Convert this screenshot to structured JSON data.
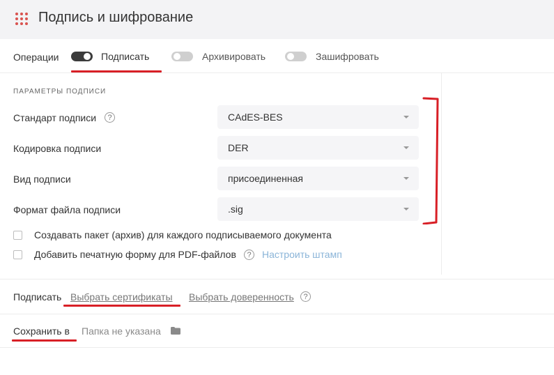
{
  "header": {
    "title": "Подпись и шифрование",
    "icon": "grid-dots-icon",
    "icon_color": "#d9534f"
  },
  "operations": {
    "label": "Операции",
    "toggles": [
      {
        "label": "Подписать",
        "on": true
      },
      {
        "label": "Архивировать",
        "on": false
      },
      {
        "label": "Зашифровать",
        "on": false
      }
    ]
  },
  "params": {
    "section_title": "ПАРАМЕТРЫ ПОДПИСИ",
    "rows": [
      {
        "label": "Стандарт подписи",
        "value": "CAdES-BES",
        "help": "?"
      },
      {
        "label": "Кодировка подписи",
        "value": "DER"
      },
      {
        "label": "Вид подписи",
        "value": "присоединенная"
      },
      {
        "label": "Формат файла подписи",
        "value": ".sig"
      }
    ],
    "checkboxes": [
      {
        "label": "Создавать пакет (архив) для каждого подписываемого документа",
        "checked": false
      },
      {
        "label": "Добавить печатную форму для PDF-файлов",
        "checked": false
      }
    ],
    "pdf_help": "?",
    "stamp_link": "Настроить штамп"
  },
  "sign": {
    "label": "Подписать",
    "choose_certificates": "Выбрать сертификаты",
    "choose_power_of_attorney": "Выбрать доверенность",
    "help": "?"
  },
  "save": {
    "label": "Сохранить в",
    "folder_placeholder": "Папка не указана",
    "folder_icon": "folder-icon"
  },
  "annotation_color": "#d81f26"
}
